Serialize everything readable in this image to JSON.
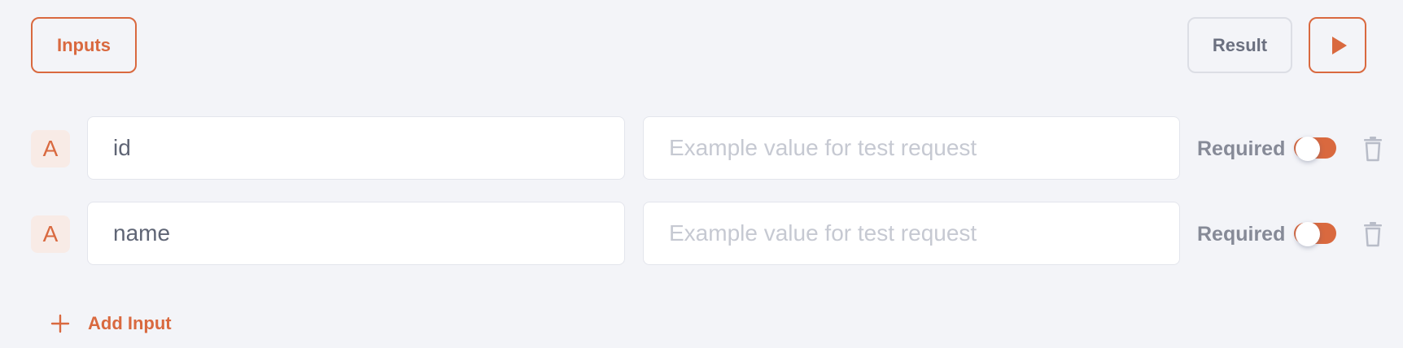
{
  "toolbar": {
    "inputs_label": "Inputs",
    "result_label": "Result",
    "run_icon": "play-icon"
  },
  "inputs": [
    {
      "type_badge": "A",
      "name": "id",
      "example_placeholder": "Example value for test request",
      "required_label": "Required",
      "required": true
    },
    {
      "type_badge": "A",
      "name": "name",
      "example_placeholder": "Example value for test request",
      "required_label": "Required",
      "required": true
    }
  ],
  "add_input": {
    "label": "Add Input",
    "icon": "plus-icon"
  },
  "colors": {
    "accent": "#d9693f",
    "background": "#f3f4f8",
    "muted_text": "#868a97",
    "placeholder": "#c6c9d2"
  }
}
